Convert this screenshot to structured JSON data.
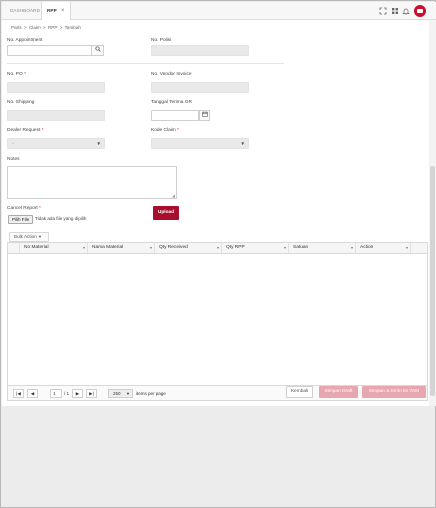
{
  "tabs": {
    "dashboard": "DASHBOARD",
    "rpp": "RPP",
    "close": "×"
  },
  "breadcrumb": [
    "Parts",
    ">",
    "Claim",
    ">",
    "RPP",
    ">",
    "Tambah"
  ],
  "form": {
    "no_appointment_label": "No. Appointment",
    "no_polisi_label": "No. Polisi",
    "no_po_label": "No. PO",
    "no_vendor_invoice_label": "No. Vendor Invoice",
    "no_shipping_label": "No. Shipping",
    "tanggal_terima_gr_label": "Tanggal Terima GR",
    "dealer_request_label": "Dealer Request",
    "dealer_request_value": "-",
    "kode_claim_label": "Kode Claim",
    "notes_label": "Notes",
    "cancel_report_label": "Cancel Report",
    "required_mark": "*",
    "file_button": "Pilih File",
    "file_status": "Tidak ada file yang dipilih",
    "upload_button": "Upload"
  },
  "grid": {
    "bulk_action": "Bulk Action",
    "columns": [
      "No Material",
      "Nama Material",
      "Qty Received",
      "Qty RPP",
      "Satuan",
      "Action"
    ],
    "rows": [],
    "pager": {
      "first": "|◀",
      "prev": "◀",
      "page": "1",
      "of": "/ 1",
      "next": "▶",
      "last": "▶|",
      "page_size": "250",
      "items_per_page": "items per page"
    }
  },
  "footer": {
    "kembali": "Kembali",
    "simpan_draft": "Simpan Draft",
    "simpan_kirim": "Simpan & Kirim ke TAM"
  },
  "colors": {
    "brand_red": "#a90f2c",
    "disabled_button": "#e8a6b1",
    "disabled_input": "#e9e9e9"
  },
  "icons": {
    "search": "search-icon",
    "calendar": "calendar-icon",
    "fullscreen": "fullscreen-icon",
    "grid": "grid-icon",
    "bell": "bell-icon",
    "user": "user-avatar"
  }
}
